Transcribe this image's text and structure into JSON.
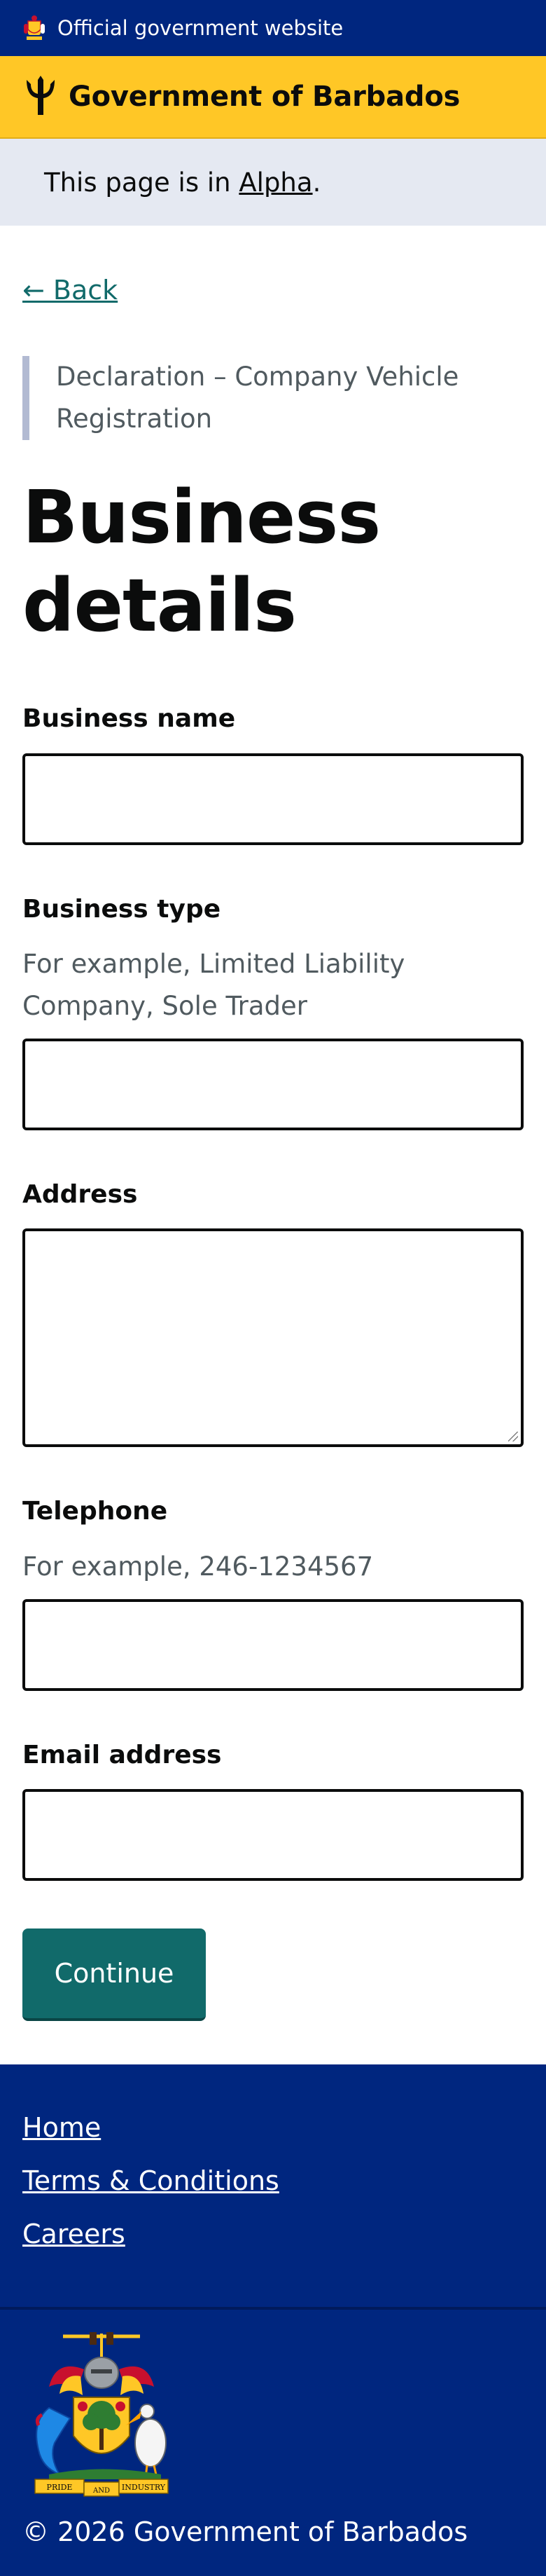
{
  "official_banner": {
    "text": "Official government website",
    "icon": "coat-of-arms-icon"
  },
  "brand": {
    "title": "Government of Barbados",
    "icon": "trident-icon"
  },
  "phase": {
    "prefix": "This page is in ",
    "link": "Alpha",
    "suffix": "."
  },
  "back_link": "← Back",
  "caption": "Declaration – Company Vehicle Registration",
  "page_title": "Business details",
  "form": {
    "business_name": {
      "label": "Business name",
      "value": ""
    },
    "business_type": {
      "label": "Business type",
      "hint": "For example, Limited Liability Company, Sole Trader",
      "value": ""
    },
    "address": {
      "label": "Address",
      "value": ""
    },
    "telephone": {
      "label": "Telephone",
      "hint": "For example, 246-1234567",
      "value": ""
    },
    "email": {
      "label": "Email address",
      "value": ""
    }
  },
  "continue_label": "Continue",
  "footer": {
    "links": [
      "Home",
      "Terms & Conditions",
      "Careers"
    ],
    "copyright": "© 2026 Government of Barbados",
    "crest_motto_left": "PRIDE",
    "crest_motto_mid": "AND",
    "crest_motto_right": "INDUSTRY"
  },
  "colors": {
    "official_blue": "#00267f",
    "brand_yellow": "#ffc726",
    "phase_bg": "#e5e9f2",
    "accent_teal": "#116a6a",
    "caption_border": "#b2bad2"
  }
}
